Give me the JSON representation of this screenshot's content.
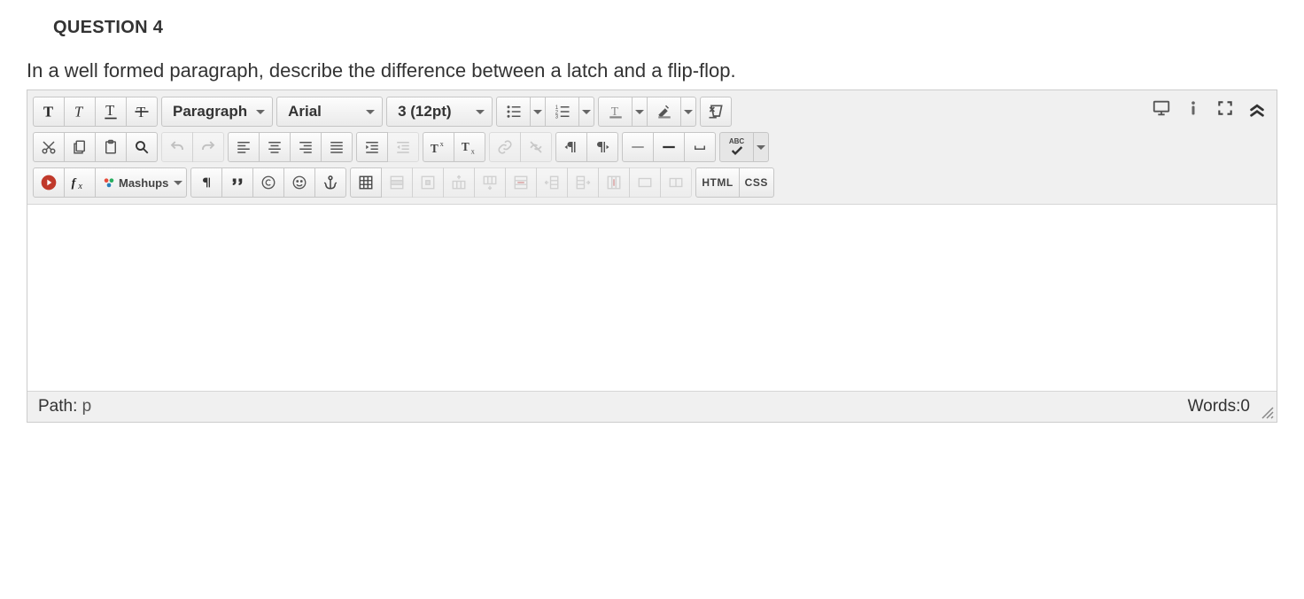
{
  "question": {
    "title": "QUESTION 4",
    "prompt": "In a well formed paragraph, describe the difference between a latch and a flip-flop."
  },
  "toolbar": {
    "selects": {
      "format": "Paragraph",
      "font": "Arial",
      "size": "3 (12pt)"
    },
    "mashups_label": "Mashups",
    "html_label": "HTML",
    "css_label": "CSS",
    "spellcheck_abc": "ABC"
  },
  "status": {
    "path_label": "Path:",
    "path_value": "p",
    "words_label": "Words:",
    "words_value": "0"
  }
}
